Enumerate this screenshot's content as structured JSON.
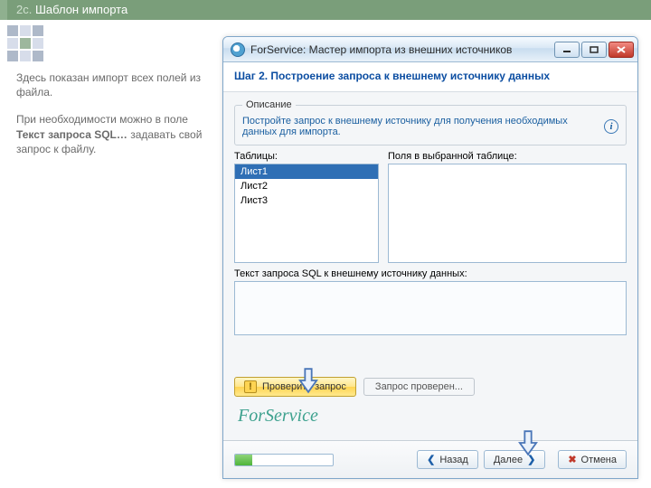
{
  "slide": {
    "prefix": "2c.",
    "title": "Шаблон импорта",
    "explain_p1": "Здесь показан импорт всех полей из файла.",
    "explain_p2_before": "При необходимости можно в поле ",
    "explain_p2_bold": "Текст запроса SQL…",
    "explain_p2_after": " задавать свой запрос к файлу."
  },
  "window": {
    "title": "ForService: Мастер импорта из внешних источников",
    "step_title": "Шаг 2. Построение запроса к внешнему источнику данных",
    "description_legend": "Описание",
    "description_text": "Постройте запрос к внешнему источнику для получения необходимых данных для импорта.",
    "tables_label": "Таблицы:",
    "fields_label": "Поля в выбранной таблице:",
    "tables": [
      {
        "label": "Лист1",
        "selected": true
      },
      {
        "label": "Лист2",
        "selected": false
      },
      {
        "label": "Лист3",
        "selected": false
      }
    ],
    "sql_label": "Текст запроса SQL к внешнему источнику данных:",
    "check_button": "Проверить запрос",
    "check_status": "Запрос проверен...",
    "brand": "ForService",
    "nav": {
      "back": "Назад",
      "next": "Далее",
      "cancel": "Отмена"
    }
  }
}
